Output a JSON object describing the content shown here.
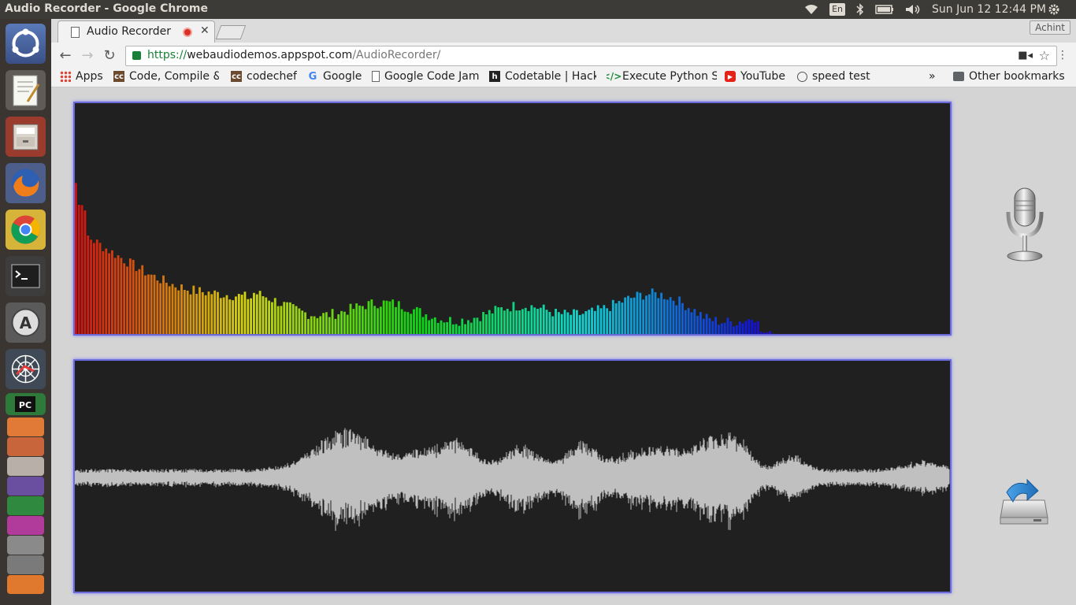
{
  "window": {
    "title": "Audio Recorder - Google Chrome"
  },
  "system": {
    "lang": "En",
    "clock": "Sun Jun 12 12:44 PM"
  },
  "browser": {
    "tab": {
      "title": "Audio Recorder"
    },
    "user": "Achint",
    "url": {
      "scheme": "https://",
      "host": "webaudiodemos.appspot.com",
      "path": "/AudioRecorder/"
    },
    "bookmarks": [
      {
        "label": "Apps",
        "icon": "apps-grid-icon"
      },
      {
        "label": "Code, Compile &",
        "icon": "codechef-icon"
      },
      {
        "label": "codechef",
        "icon": "codechef-icon"
      },
      {
        "label": "Google",
        "icon": "google-icon"
      },
      {
        "label": "Google Code Jam",
        "icon": "page-icon"
      },
      {
        "label": "Codetable | Hacke",
        "icon": "codetable-icon"
      },
      {
        "label": "Execute Python S",
        "icon": "code-icon"
      },
      {
        "label": "YouTube",
        "icon": "youtube-icon"
      },
      {
        "label": "speed test",
        "icon": "gauge-icon"
      }
    ],
    "overflow": "»",
    "other_bookmarks": "Other bookmarks"
  },
  "app": {
    "record_button": {
      "icon": "microphone-icon"
    },
    "save_button": {
      "icon": "save-download-icon"
    }
  }
}
